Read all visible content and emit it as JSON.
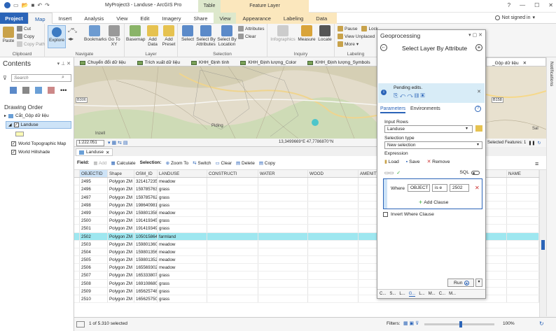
{
  "app": {
    "title": "MyProject3 - Landuse - ArcGIS Pro",
    "ctx_table": "Table",
    "ctx_feature_layer": "Feature Layer",
    "help": "?",
    "sign_in": "Not signed in"
  },
  "tabs": [
    "Project",
    "Map",
    "Insert",
    "Analysis",
    "View",
    "Edit",
    "Imagery",
    "Share",
    "View",
    "Appearance",
    "Labeling",
    "Data"
  ],
  "ribbon": {
    "clipboard": {
      "label": "Clipboard",
      "paste": "Paste",
      "cut": "Cut",
      "copy": "Copy",
      "copy_path": "Copy Path"
    },
    "navigate": {
      "label": "Navigate",
      "explore": "Explore",
      "bookmarks": "Bookmarks",
      "goto": "Go To XY"
    },
    "layer": {
      "label": "Layer",
      "basemap": "Basemap",
      "add_data": "Add Data",
      "add_preset": "Add Preset"
    },
    "selection": {
      "label": "Selection",
      "select": "Select",
      "by_attr": "Select By Attributes",
      "by_loc": "Select By Location",
      "attributes": "Attributes",
      "clear": "Clear"
    },
    "inquiry": {
      "label": "Inquiry",
      "infographics": "Infographics",
      "measure": "Measure",
      "locate": "Locate"
    },
    "labeling": {
      "label": "Labeling",
      "pause": "Pause",
      "lock": "Lock",
      "view_unplaced": "View Unplaced",
      "more": "More"
    }
  },
  "contents": {
    "title": "Contents",
    "search_placeholder": "Search",
    "drawing_order": "Drawing Order",
    "map_name": "Cắt_Gộp dữ liệu",
    "layers": [
      "Landuse",
      "World Topographic Map",
      "World Hillshade"
    ]
  },
  "map_tabs": [
    "Chuyển đổi dữ liệu",
    "Trích xuất dữ liệu",
    "KHH_Định tính",
    "KHH_Định lượng_Color",
    "KHH_Định lượng_Symbols",
    "_Gộp dữ liệu"
  ],
  "map": {
    "scale": "1:222.051",
    "coords": "13,3499669°E 47,7786870°N",
    "selected_features": "Selected Features: 1",
    "place1": "Inzell",
    "place2": "Piding",
    "road1": "B306",
    "road2": "B158",
    "place3": "Sal"
  },
  "table": {
    "tab": "Landuse",
    "field_lbl": "Field:",
    "add": "Add",
    "calculate": "Calculate",
    "selection_lbl": "Selection:",
    "zoom_to": "Zoom To",
    "switch": "Switch",
    "clear": "Clear",
    "delete": "Delete",
    "copy": "Copy",
    "columns": [
      "OBJECTID",
      "Shape",
      "OSM_ID",
      "LANDUSE",
      "CONSTRUCTI",
      "WATER",
      "WOOD",
      "AMENITY",
      "NAME"
    ],
    "rows": [
      [
        "2495",
        "Polygon ZM",
        "321417235",
        "meadow"
      ],
      [
        "2496",
        "Polygon ZM",
        "159785763",
        "grass"
      ],
      [
        "2497",
        "Polygon ZM",
        "159785762",
        "grass"
      ],
      [
        "2498",
        "Polygon ZM",
        "198640981",
        "grass"
      ],
      [
        "2499",
        "Polygon ZM",
        "159801358",
        "meadow"
      ],
      [
        "2500",
        "Polygon ZM",
        "191419345",
        "grass"
      ],
      [
        "2501",
        "Polygon ZM",
        "191419349",
        "grass"
      ],
      [
        "2502",
        "Polygon ZM",
        "105015864",
        "farmland"
      ],
      [
        "2503",
        "Polygon ZM",
        "159801360",
        "meadow"
      ],
      [
        "2504",
        "Polygon ZM",
        "159801356",
        "meadow"
      ],
      [
        "2505",
        "Polygon ZM",
        "159801352",
        "meadow"
      ],
      [
        "2506",
        "Polygon ZM",
        "165569302",
        "meadow"
      ],
      [
        "2507",
        "Polygon ZM",
        "165333807",
        "grass"
      ],
      [
        "2508",
        "Polygon ZM",
        "169108680",
        "grass"
      ],
      [
        "2509",
        "Polygon ZM",
        "165625748",
        "grass"
      ],
      [
        "2510",
        "Polygon ZM",
        "165625750",
        "grass"
      ]
    ],
    "selected_row": "2502",
    "footer": "1 of 5.310 selected",
    "filters_lbl": "Filters:",
    "zoom": "100%"
  },
  "geoprocessing": {
    "title": "Geoprocessing",
    "tool": "Select Layer By Attribute",
    "pending": "Pending edits.",
    "tab_params": "Parameters",
    "tab_env": "Environments",
    "input_rows_lbl": "Input Rows",
    "input_rows": "Landuse",
    "sel_type_lbl": "Selection type",
    "sel_type": "New selection",
    "expression_lbl": "Expression",
    "load": "Load",
    "save": "Save",
    "remove": "Remove",
    "sql": "SQL",
    "where": "Where",
    "field": "OBJECT",
    "operator": "is e",
    "value": "2502",
    "add_clause": "Add Clause",
    "invert": "Invert Where Clause",
    "run": "Run",
    "bottom_tabs": [
      "C...",
      "S...",
      "L...",
      "G...",
      "L...",
      "M...",
      "C...",
      "M..."
    ]
  },
  "notifications": "Notifications",
  "colors": {
    "accent": "#2b64b8",
    "selected_row": "#9ee7f0",
    "pending_bg": "#d8ecf7"
  }
}
